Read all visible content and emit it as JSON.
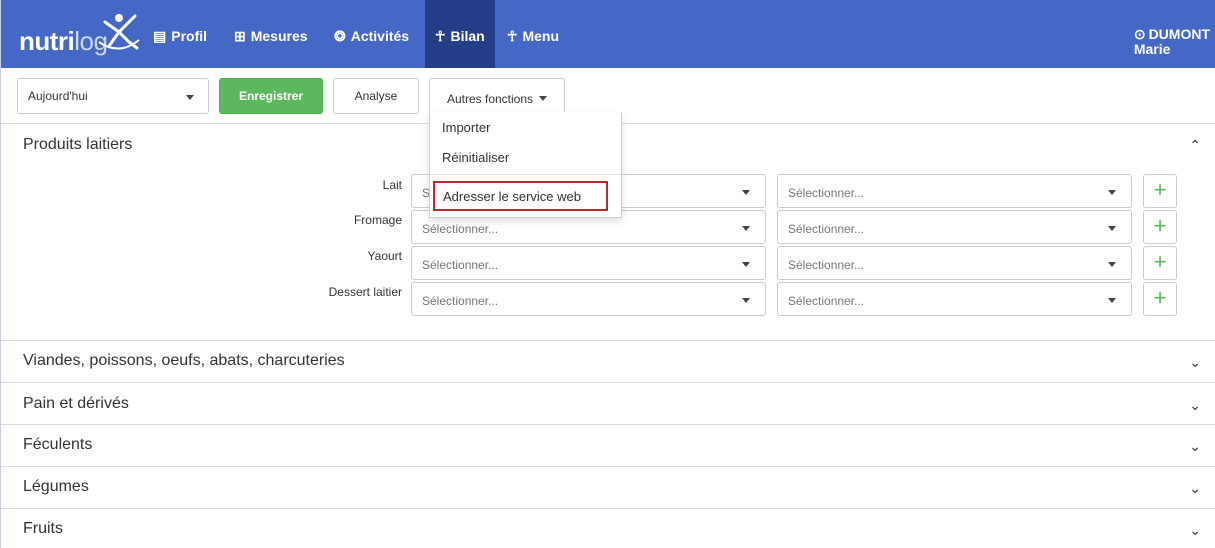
{
  "navbar": {
    "logo": {
      "bold": "nutri",
      "thin": "log"
    },
    "items": [
      {
        "label": "Profil",
        "icon": "id-card-icon",
        "glyph": "▤"
      },
      {
        "label": "Mesures",
        "icon": "table-icon",
        "glyph": "⊞"
      },
      {
        "label": "Activités",
        "icon": "soccer-ball-icon",
        "glyph": "❂"
      },
      {
        "label": "Bilan",
        "icon": "cutlery-icon",
        "glyph": "☥"
      },
      {
        "label": "Menu",
        "icon": "cutlery-icon",
        "glyph": "☥"
      }
    ],
    "active": "Bilan",
    "user": {
      "last_name": "DUMONT",
      "first_name": "Marie",
      "icon": "user-circle-icon",
      "glyph": "⊙"
    },
    "bg_color": "#4568c6",
    "active_color": "#243e8a"
  },
  "toolbar": {
    "date_value": "Aujourd'hui",
    "save_label": "Enregistrer",
    "analyse_label": "Analyse",
    "more_label": "Autres fonctions",
    "save_color": "#5cb85c"
  },
  "more_menu": {
    "items": [
      "Importer",
      "Réinitialiser",
      "Adresser le service web"
    ],
    "highlight_color": "#c0292c"
  },
  "sections": {
    "open": {
      "title": "Produits laitiers",
      "rows": [
        {
          "label": "Lait",
          "select1": "S",
          "select2": "Sélectionner..."
        },
        {
          "label": "Fromage",
          "select1": "Sélectionner...",
          "select2": "Sélectionner..."
        },
        {
          "label": "Yaourt",
          "select1": "Sélectionner...",
          "select2": "Sélectionner..."
        },
        {
          "label": "Dessert laitier",
          "select1": "Sélectionner...",
          "select2": "Sélectionner..."
        }
      ]
    },
    "collapsed": [
      "Viandes, poissons, oeufs, abats, charcuteries",
      "Pain et dérivés",
      "Féculents",
      "Légumes",
      "Fruits"
    ]
  },
  "icons": {
    "plus": "+",
    "chevron_up": "⌃",
    "chevron_down": "⌄"
  }
}
